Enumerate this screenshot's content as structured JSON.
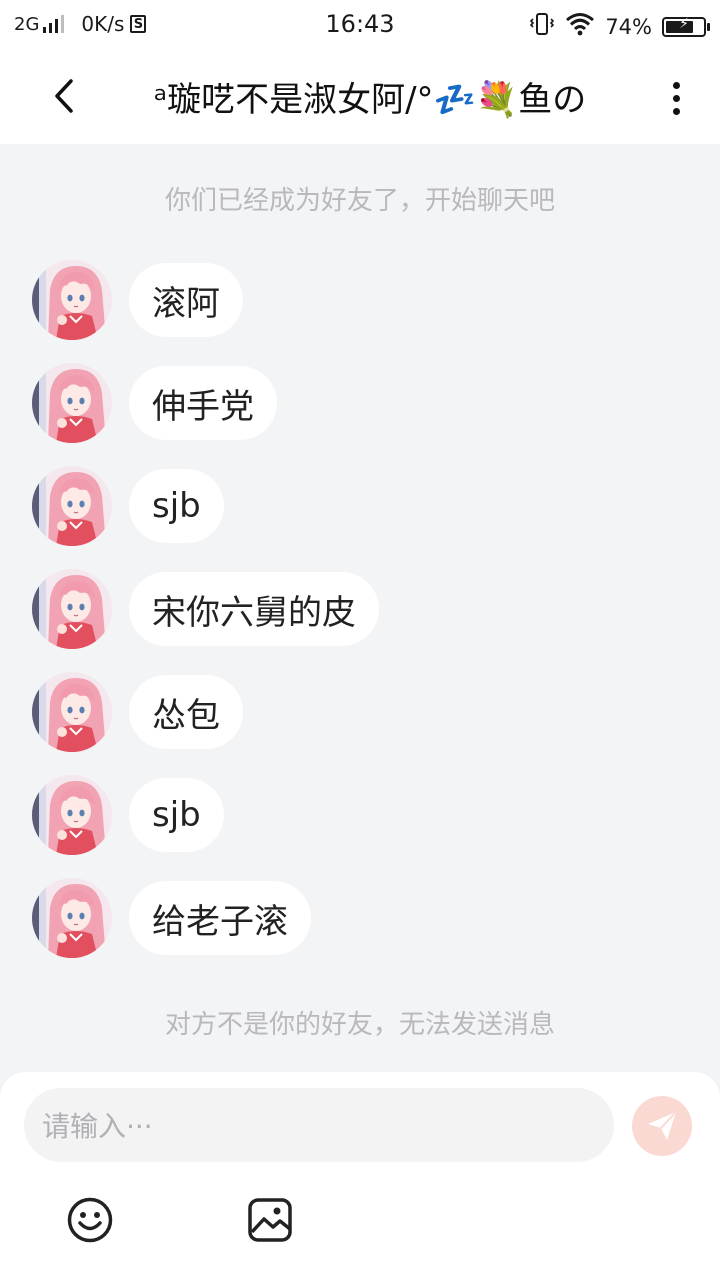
{
  "status_bar": {
    "network": "2G",
    "speed": "0K/s",
    "s_badge": "S",
    "time": "16:43",
    "battery_percent": "74%",
    "battery_level": 0.74
  },
  "header": {
    "title": "ᵃ璇呓不是淑女阿/°💤💐鱼の"
  },
  "chat": {
    "friend_notice": "你们已经成为好友了，开始聊天吧",
    "messages": [
      {
        "text": "滚阿"
      },
      {
        "text": "伸手党"
      },
      {
        "text": "sjb"
      },
      {
        "text": "宋你六舅的皮"
      },
      {
        "text": "怂包"
      },
      {
        "text": "sjb"
      },
      {
        "text": "给老子滚"
      }
    ],
    "not_friend_notice": "对方不是你的好友，无法发送消息"
  },
  "input": {
    "placeholder": "请输入···"
  },
  "icons": {
    "back": "chevron-left-icon",
    "more": "more-vertical-icon",
    "send": "paper-plane-icon",
    "emoji": "smiley-icon",
    "image": "image-icon"
  },
  "colors": {
    "background": "#f3f4f6",
    "bubble": "#ffffff",
    "send_button": "#fbd9d3",
    "send_icon": "#ffffff"
  }
}
